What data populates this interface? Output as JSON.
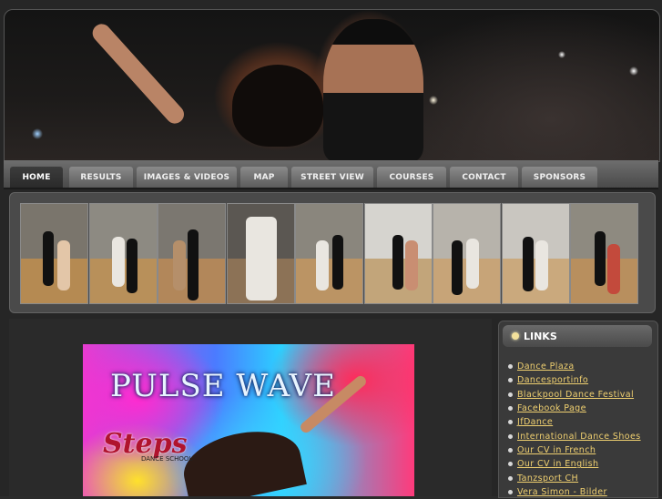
{
  "nav": {
    "items": [
      {
        "label": "HOME",
        "active": true
      },
      {
        "label": "RESULTS",
        "active": false
      },
      {
        "label": "IMAGES & VIDEOS",
        "active": false
      },
      {
        "label": "MAP",
        "active": false
      },
      {
        "label": "STREET VIEW",
        "active": false
      },
      {
        "label": "COURSES",
        "active": false
      },
      {
        "label": "CONTACT",
        "active": false
      },
      {
        "label": "SPONSORS",
        "active": false
      }
    ]
  },
  "thumbnails": {
    "count": 9
  },
  "poster": {
    "line1": "PULSE WAVE",
    "line2": "Steps",
    "line3": "DANCE SCHOOL"
  },
  "sidebar": {
    "title": "LINKS",
    "links": [
      "Dance Plaza",
      "Dancesportinfo",
      "Blackpool Dance Festival",
      "Facebook Page",
      "JfDance",
      "International Dance Shoes",
      "Our CV in French",
      "Our CV in English",
      "Tanzsport CH",
      "Vera Simon - Bilder"
    ]
  },
  "colors": {
    "link": "#f0d070",
    "background": "#262626"
  }
}
